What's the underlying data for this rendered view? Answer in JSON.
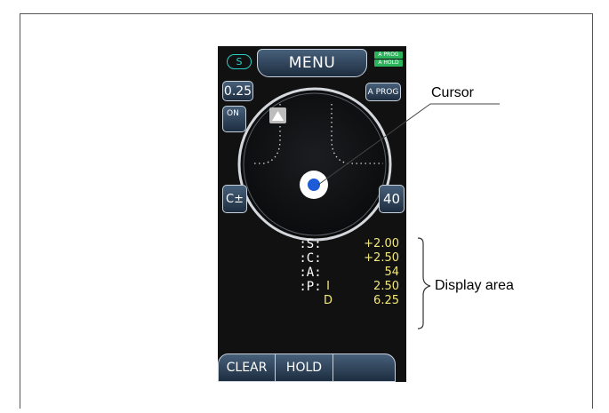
{
  "device": {
    "s_badge": "S",
    "menu_label": "MENU",
    "prog_badges": [
      "A PROG",
      "A HOLD"
    ],
    "step_value": "0.25",
    "aprog_label": "A PROG",
    "on_label": "ON",
    "cylinder_label": "C±",
    "cursor_value": "40",
    "triangle_icon": "up-triangle-icon"
  },
  "readout": [
    {
      "label": ":S:",
      "prefix": "",
      "value": "+2.00"
    },
    {
      "label": ":C:",
      "prefix": "",
      "value": "+2.50"
    },
    {
      "label": ":A:",
      "prefix": "",
      "value": "54"
    },
    {
      "label": ":P:",
      "prefix": "I",
      "value": "2.50"
    },
    {
      "label": "",
      "prefix": "D",
      "value": "6.25"
    }
  ],
  "bottom_buttons": [
    "CLEAR",
    "HOLD",
    ""
  ],
  "callouts": {
    "cursor": "Cursor",
    "display_area": "Display area"
  },
  "colors": {
    "screen_bg": "#111111",
    "readout_value": "#f2e87a",
    "cursor_dot": "#1e5bd6",
    "badge_green": "#2bb45c",
    "s_badge_cyan": "#2ad0c8"
  }
}
